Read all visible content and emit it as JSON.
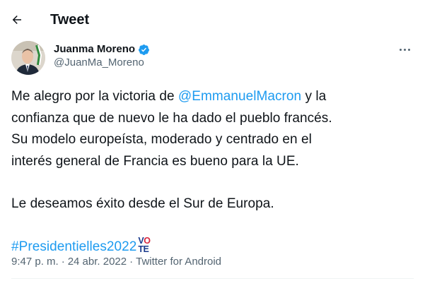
{
  "header": {
    "title": "Tweet",
    "back_icon": "arrow-left-icon"
  },
  "author": {
    "name": "Juanma Moreno",
    "handle": "@JuanMa_Moreno",
    "verified": true,
    "verified_color": "#1d9bf0"
  },
  "tweet": {
    "line1_before": "Me alegro por la victoria de ",
    "mention": "@EmmanuelMacron",
    "line1_after": " y la",
    "line2": "confianza que de nuevo le ha dado el pueblo francés.",
    "line3": "Su modelo europeísta, moderado y centrado en el",
    "line4": "interés general de Francia es bueno para la UE.",
    "line5": "Le deseamos éxito desde el Sur de Europa.",
    "hashtag": "#Presidentielles2022",
    "hashtag_emoji_top": "VO",
    "hashtag_emoji_bottom": "TE",
    "link_color": "#1d9bf0"
  },
  "meta": {
    "time": "9:47 p. m.",
    "separator": "·",
    "date": "24 abr. 2022",
    "source": "Twitter for Android"
  }
}
